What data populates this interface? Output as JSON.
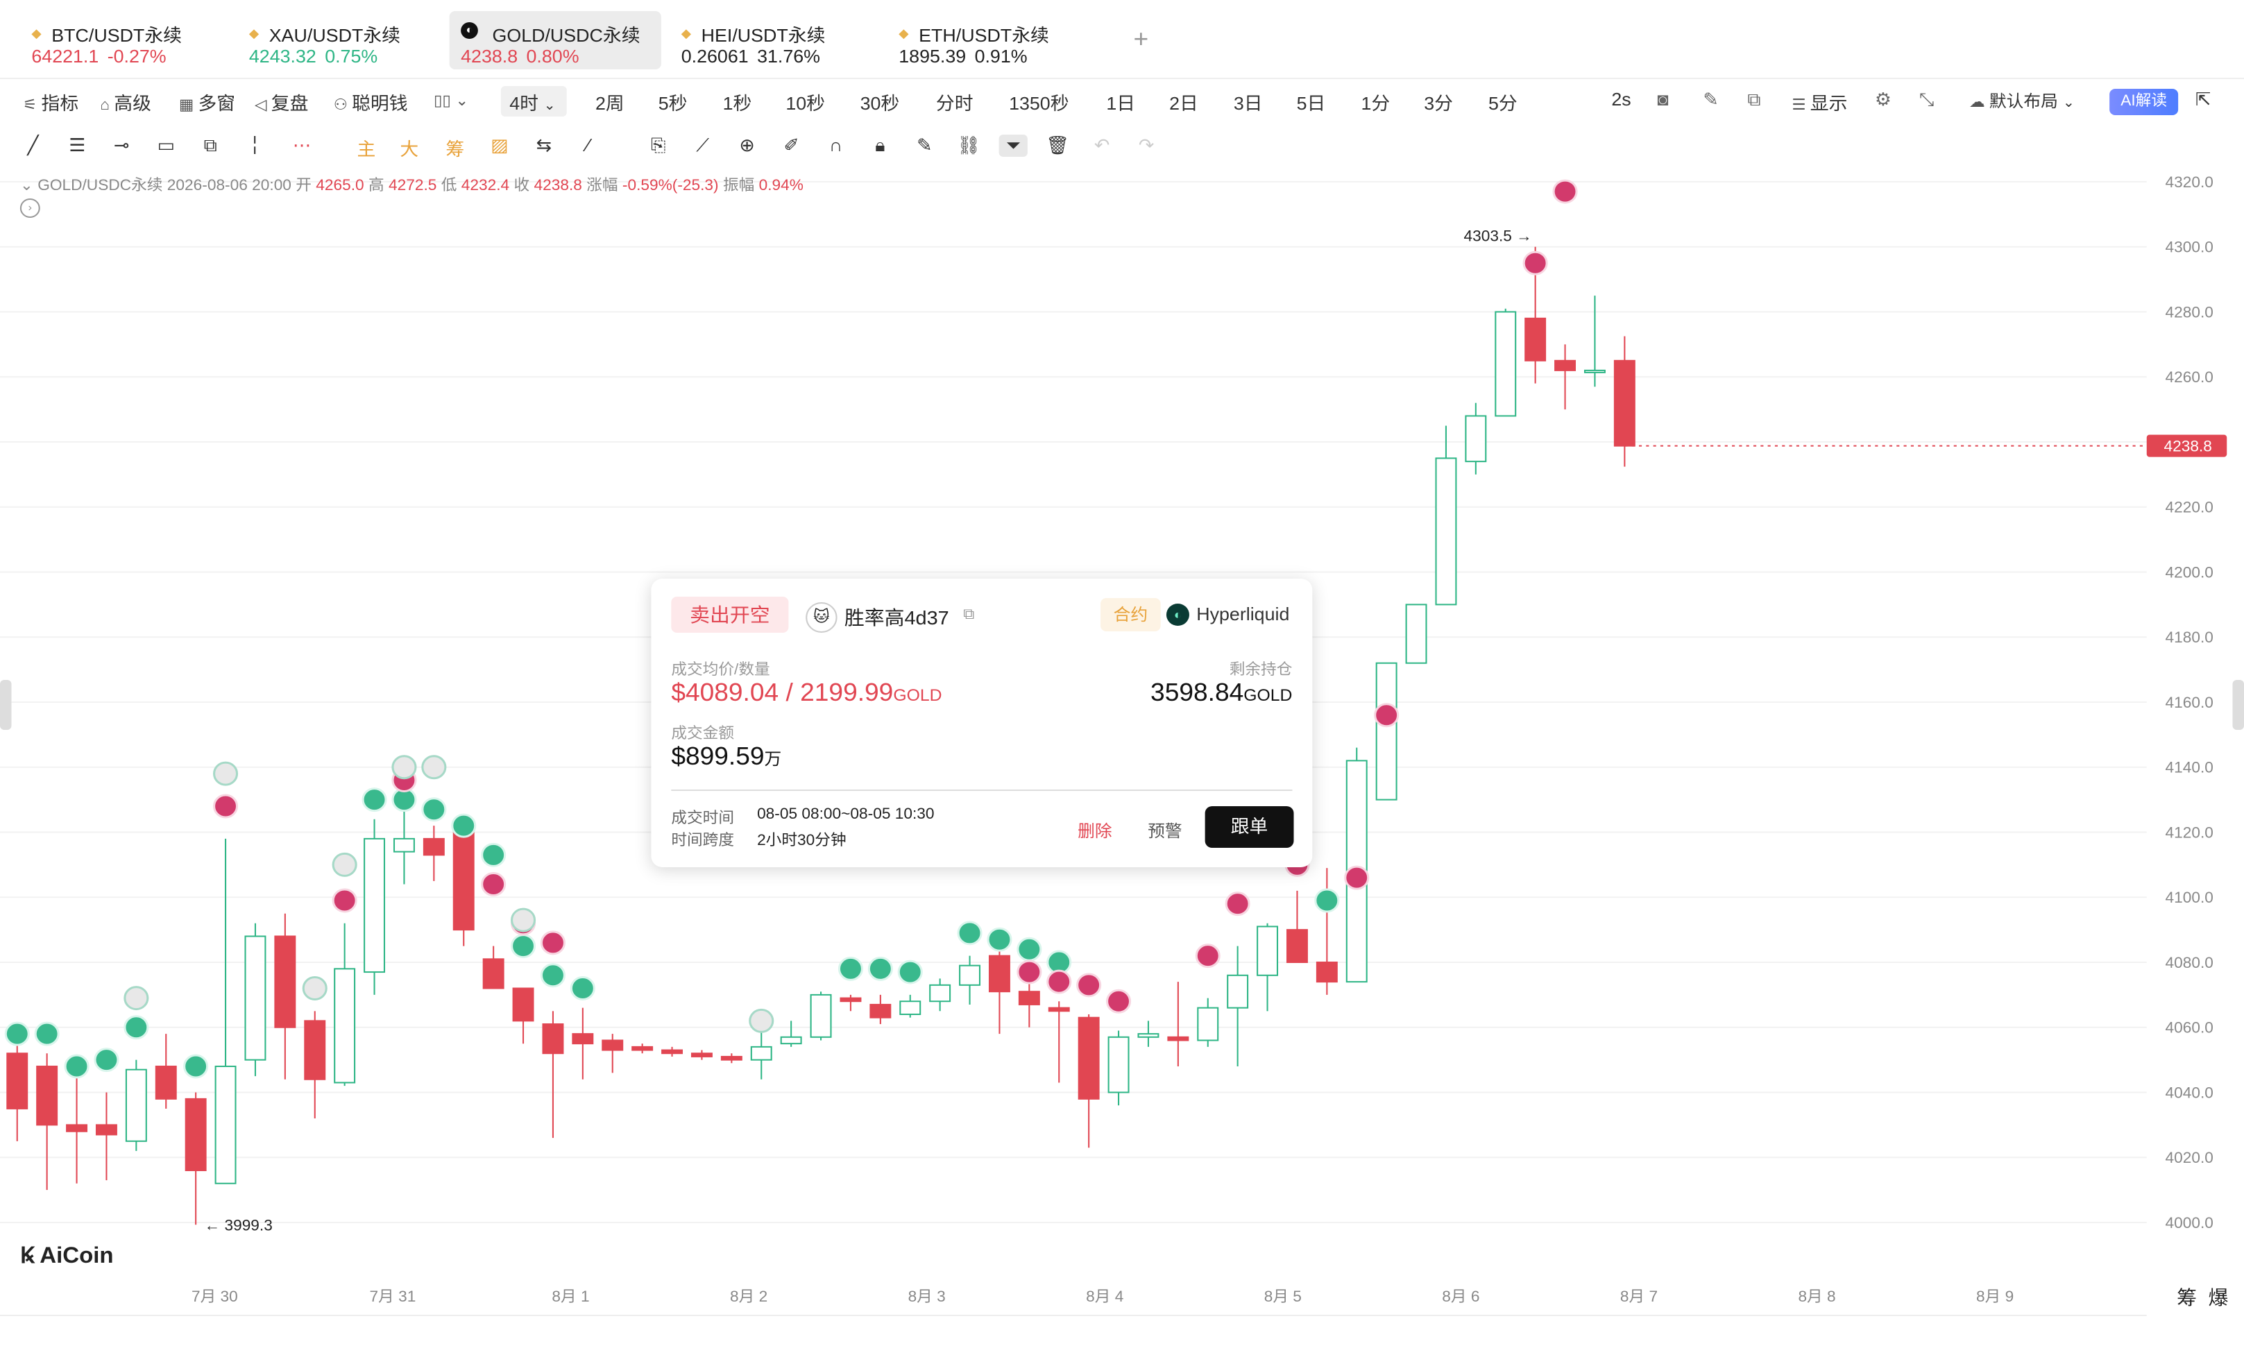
{
  "tickers": [
    {
      "name": "BTC/USDT永续",
      "price": "64221.1",
      "change": "-0.27%",
      "dir": "neg",
      "active": false
    },
    {
      "name": "XAU/USDT永续",
      "price": "4243.32",
      "change": "0.75%",
      "dir": "pos",
      "active": false
    },
    {
      "name": "GOLD/USDC永续",
      "price": "4238.8",
      "change": "0.80%",
      "dir": "neg",
      "active": true
    },
    {
      "name": "HEI/USDT永续",
      "price": "0.26061",
      "change": "31.76%",
      "dir": "none",
      "active": false
    },
    {
      "name": "ETH/USDT永续",
      "price": "1895.39",
      "change": "0.91%",
      "dir": "none",
      "active": false
    }
  ],
  "add_tab": "+",
  "toolbar": {
    "indicator": "指标",
    "advanced": "高级",
    "multi": "多窗",
    "replay": "复盘",
    "smart": "聪明钱",
    "interval_selected": "4时",
    "intervals": [
      "2周",
      "5秒",
      "1秒",
      "10秒",
      "30秒",
      "分时",
      "1350秒",
      "1日",
      "2日",
      "3日",
      "5日",
      "1分",
      "3分",
      "5分"
    ],
    "refresh": "2s",
    "display": "显示",
    "layout": "默认布局",
    "ai": "AI解读"
  },
  "drawtools": {
    "main": "主",
    "big": "大",
    "chip": "筹"
  },
  "info": {
    "symbol": "GOLD/USDC永续",
    "time": "2026-08-06 20:00",
    "open_l": "开",
    "open": "4265.0",
    "high_l": "高",
    "high": "4272.5",
    "low_l": "低",
    "low": "4232.4",
    "close_l": "收",
    "close": "4238.8",
    "chg_l": "涨幅",
    "chg": "-0.59%(-25.3)",
    "amp_l": "振幅",
    "amp": "0.94%"
  },
  "brand": "AiCoin",
  "bottom_right": {
    "chip": "筹",
    "liq": "爆"
  },
  "popup": {
    "side": "卖出开空",
    "trader": "胜率高4d37",
    "contract": "合约",
    "exchange": "Hyperliquid",
    "avg_label": "成交均价/数量",
    "avg_price": "$4089.04",
    "avg_sep": " / ",
    "avg_qty": "2199.99",
    "avg_unit": "GOLD",
    "hold_label": "剩余持仓",
    "hold_qty": "3598.84",
    "hold_unit": "GOLD",
    "amount_label": "成交金额",
    "amount": "$899.59",
    "amount_unit": "万",
    "time_label": "成交时间",
    "time_value": "08-05 08:00~08-05 10:30",
    "span_label": "时间跨度",
    "span_value": "2小时30分钟",
    "delete": "删除",
    "alert": "预警",
    "follow": "跟单"
  },
  "colors": {
    "up": "#2db585",
    "down": "#e14652",
    "grid": "#f2f2f2",
    "axis_text": "#888"
  },
  "chart_data": {
    "type": "candlestick",
    "ylim": [
      4000,
      4320
    ],
    "y_ticks": [
      "4320.0",
      "4300.0",
      "4280.0",
      "4260.0",
      "4240.0",
      "4220.0",
      "4200.0",
      "4180.0",
      "4160.0",
      "4140.0",
      "4120.0",
      "4100.0",
      "4080.0",
      "4060.0",
      "4040.0",
      "4020.0",
      "4000.0"
    ],
    "x_ticks": [
      "7月 30",
      "7月 31",
      "8月 1",
      "8月 2",
      "8月 3",
      "8月 4",
      "8月 5",
      "8月 6",
      "8月 7",
      "8月 8",
      "8月 9"
    ],
    "last_price": "4238.8",
    "high_mark": "4303.5",
    "low_mark": "3999.3",
    "candles": [
      [
        4052,
        4055,
        4025,
        4035
      ],
      [
        4048,
        4052,
        4010,
        4030
      ],
      [
        4030,
        4045,
        4012,
        4028
      ],
      [
        4030,
        4040,
        4013,
        4027
      ],
      [
        4025,
        4050,
        4022,
        4047
      ],
      [
        4048,
        4058,
        4035,
        4038
      ],
      [
        4038,
        4040,
        3999.3,
        4016
      ],
      [
        4012,
        4118,
        4012,
        4048
      ],
      [
        4050,
        4092,
        4045,
        4088
      ],
      [
        4088,
        4095,
        4044,
        4060
      ],
      [
        4062,
        4065,
        4032,
        4044
      ],
      [
        4043,
        4092,
        4042,
        4078
      ],
      [
        4077,
        4124,
        4070,
        4118
      ],
      [
        4114,
        4135,
        4104,
        4118
      ],
      [
        4118,
        4122,
        4105,
        4113
      ],
      [
        4122,
        4122,
        4085,
        4090
      ],
      [
        4081,
        4085,
        4073,
        4072
      ],
      [
        4072,
        4070,
        4055,
        4062
      ],
      [
        4061,
        4065,
        4026,
        4052
      ],
      [
        4058,
        4066,
        4044,
        4055
      ],
      [
        4056,
        4058,
        4046,
        4053
      ],
      [
        4054,
        4055,
        4052,
        4053
      ],
      [
        4053,
        4054,
        4051,
        4052
      ],
      [
        4052,
        4053,
        4050,
        4051
      ],
      [
        4051,
        4052,
        4049,
        4050
      ],
      [
        4050,
        4060,
        4044,
        4054
      ],
      [
        4055,
        4062,
        4054,
        4057
      ],
      [
        4057,
        4071,
        4056,
        4070
      ],
      [
        4069,
        4070,
        4065,
        4068
      ],
      [
        4067,
        4070,
        4061,
        4063
      ],
      [
        4064,
        4070,
        4063,
        4068
      ],
      [
        4068,
        4075,
        4065,
        4073
      ],
      [
        4073,
        4082,
        4067,
        4079
      ],
      [
        4082,
        4085,
        4058,
        4071
      ],
      [
        4071,
        4077,
        4060,
        4067
      ],
      [
        4066,
        4068,
        4043,
        4065
      ],
      [
        4063,
        4064,
        4023,
        4038
      ],
      [
        4040,
        4059,
        4036,
        4057
      ],
      [
        4057,
        4062,
        4054,
        4058
      ],
      [
        4057,
        4074,
        4048,
        4056
      ],
      [
        4056,
        4069,
        4054,
        4066
      ],
      [
        4066,
        4085,
        4048,
        4076
      ],
      [
        4076,
        4092,
        4065,
        4091
      ],
      [
        4090,
        4102,
        4080,
        4080
      ],
      [
        4080,
        4109,
        4070,
        4074
      ],
      [
        4074,
        4146,
        4074,
        4142
      ],
      [
        4130,
        4170,
        4130,
        4172
      ],
      [
        4172,
        4178,
        4172,
        4190
      ],
      [
        4190,
        4245,
        4190,
        4235
      ],
      [
        4234,
        4252,
        4230,
        4248
      ],
      [
        4248,
        4281,
        4248,
        4280
      ],
      [
        4278,
        4300,
        4258,
        4265
      ],
      [
        4265,
        4270,
        4250,
        4262
      ],
      [
        4262,
        4285,
        4257,
        4262
      ],
      [
        4265,
        4272.5,
        4232.4,
        4238.8
      ]
    ]
  },
  "markers": {
    "buy": [
      [
        0,
        4058
      ],
      [
        1,
        4058
      ],
      [
        2,
        4048
      ],
      [
        3,
        4050
      ],
      [
        4,
        4060
      ],
      [
        6,
        4048
      ],
      [
        12,
        4130
      ],
      [
        13,
        4130
      ],
      [
        14,
        4127
      ],
      [
        15,
        4122
      ],
      [
        16,
        4113
      ],
      [
        17,
        4085
      ],
      [
        18,
        4076
      ],
      [
        19,
        4072
      ],
      [
        28,
        4078
      ],
      [
        29,
        4078
      ],
      [
        30,
        4077
      ],
      [
        32,
        4089
      ],
      [
        33,
        4087
      ],
      [
        34,
        4084
      ],
      [
        35,
        4080
      ],
      [
        44,
        4099
      ]
    ],
    "sell": [
      [
        7,
        4128
      ],
      [
        11,
        4099
      ],
      [
        13,
        4136
      ],
      [
        16,
        4104
      ],
      [
        17,
        4092
      ],
      [
        18,
        4086
      ],
      [
        34,
        4077
      ],
      [
        35,
        4074
      ],
      [
        36,
        4073
      ],
      [
        37,
        4068
      ],
      [
        40,
        4082
      ],
      [
        41,
        4098
      ],
      [
        43,
        4110
      ],
      [
        45,
        4106
      ],
      [
        46,
        4156
      ],
      [
        51,
        4295
      ],
      [
        52,
        4317
      ]
    ],
    "neutral": [
      [
        4,
        4069
      ],
      [
        7,
        4138
      ],
      [
        11,
        4110
      ],
      [
        10,
        4072
      ],
      [
        25,
        4062
      ],
      [
        13,
        4140
      ],
      [
        14,
        4140
      ],
      [
        17,
        4093
      ]
    ]
  }
}
